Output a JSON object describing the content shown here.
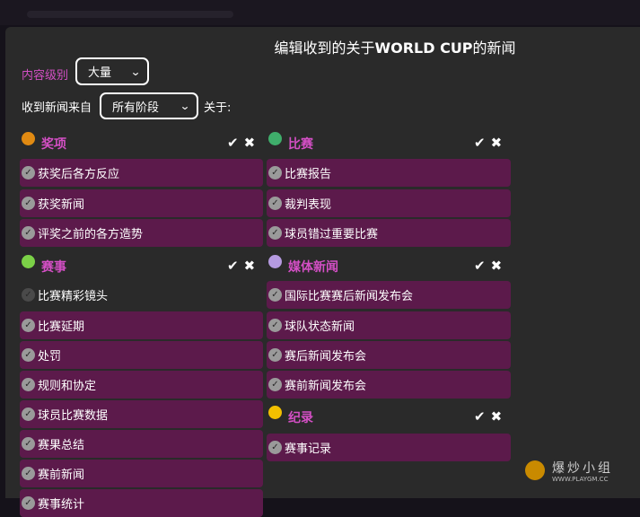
{
  "dialog": {
    "title_prefix": "编辑收到的关于",
    "title_bold": "WORLD CUP",
    "title_suffix": "的新闻"
  },
  "content_level": {
    "label": "内容级别",
    "value": "大量"
  },
  "source": {
    "label": "收到新闻来自",
    "value": "所有阶段",
    "suffix": "关于:"
  },
  "categories": {
    "awards": {
      "title": "奖项",
      "color": "#e08a12",
      "items": [
        "获奖后各方反应",
        "获奖新闻",
        "评奖之前的各方造势"
      ]
    },
    "match": {
      "title": "比赛",
      "color": "#3fae6b",
      "items": [
        "比赛报告",
        "裁判表现",
        "球员错过重要比赛"
      ]
    },
    "competition": {
      "title": "赛事",
      "color": "#7bd147",
      "items": [
        "比赛精彩镜头",
        "比赛延期",
        "处罚",
        "规则和协定",
        "球员比赛数据",
        "赛果总结",
        "赛前新闻",
        "赛事统计"
      ]
    },
    "media": {
      "title": "媒体新闻",
      "color": "#b59ae0",
      "items": [
        "国际比赛赛后新闻发布会",
        "球队状态新闻",
        "赛后新闻发布会",
        "赛前新闻发布会"
      ]
    },
    "records": {
      "title": "纪录",
      "color": "#f2c000",
      "items": [
        "赛事记录"
      ]
    }
  },
  "actions": {
    "select_all": "✔",
    "clear_all": "✖"
  },
  "icons": {
    "chevron": "chevron-down-icon",
    "check": "check-icon",
    "close": "close-icon"
  },
  "watermark": {
    "text": "爆炒小组",
    "url": "WWW.PLAYGM.CC"
  },
  "colors": {
    "accent": "#d44fc5",
    "selected_row": "#5c1a4b",
    "panel": "#2a2a2a"
  }
}
